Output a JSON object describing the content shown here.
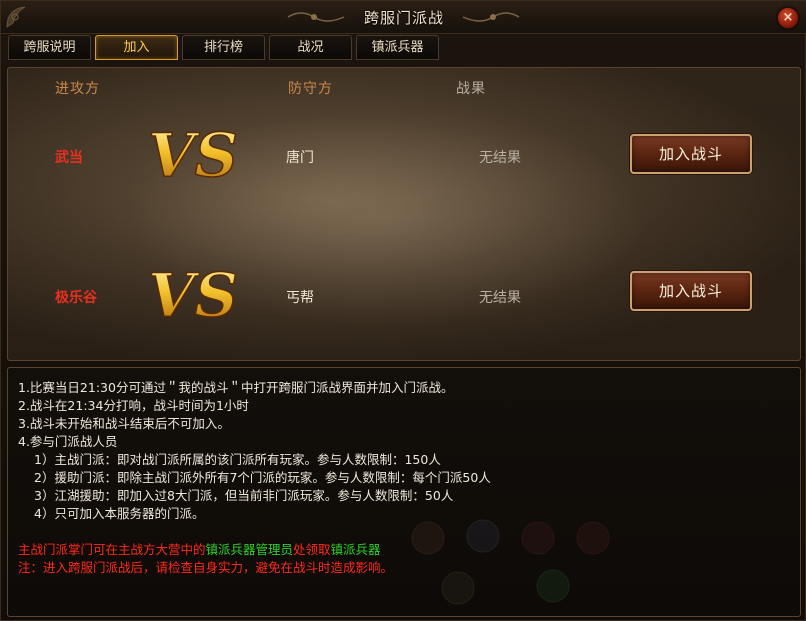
{
  "window": {
    "title": "跨服门派战",
    "close_glyph": "×"
  },
  "tabs": [
    {
      "label": "跨服说明",
      "active": false
    },
    {
      "label": "加入",
      "active": true
    },
    {
      "label": "排行榜",
      "active": false
    },
    {
      "label": "战况",
      "active": false
    },
    {
      "label": "镇派兵器",
      "active": false
    }
  ],
  "battle": {
    "headers": {
      "attack": "进攻方",
      "defend": "防守方",
      "result": "战果"
    },
    "vs_label": "VS",
    "rows": [
      {
        "attacker": "武当",
        "defender": "唐门",
        "result": "无结果",
        "button": "加入战斗"
      },
      {
        "attacker": "极乐谷",
        "defender": "丐帮",
        "result": "无结果",
        "button": "加入战斗"
      }
    ]
  },
  "rules": {
    "lines": [
      "1.比赛当日21:30分可通过＂我的战斗＂中打开跨服门派战界面并加入门派战。",
      "2.战斗在21:34分打响，战斗时间为1小时",
      "3.战斗未开始和战斗结束后不可加入。",
      "4.参与门派战人员"
    ],
    "sub_lines": [
      "1）主战门派：即对战门派所属的该门派所有玩家。参与人数限制：150人",
      "2）援助门派：即除主战门派外所有7个门派的玩家。参与人数限制：每个门派50人",
      "3）江湖援助：即加入过8大门派，但当前非门派玩家。参与人数限制：50人",
      "4）只可加入本服务器的门派。"
    ],
    "notice1": {
      "part1": "主战门派掌门可在主战方大营中的",
      "part2": "镇派兵器管理员",
      "part3": "处领取",
      "part4": "镇派兵器"
    },
    "notice2": "注：进入跨服门派战后，请检查自身实力，避免在战斗时造成影响。"
  },
  "colors": {
    "accent_gold": "#d29b2a",
    "attacker_red": "#e83020",
    "notice_red": "#ff2a1a",
    "notice_green": "#2fd12a"
  },
  "icons": {
    "close": "close-icon",
    "vs": "vs-emblem-icon"
  }
}
